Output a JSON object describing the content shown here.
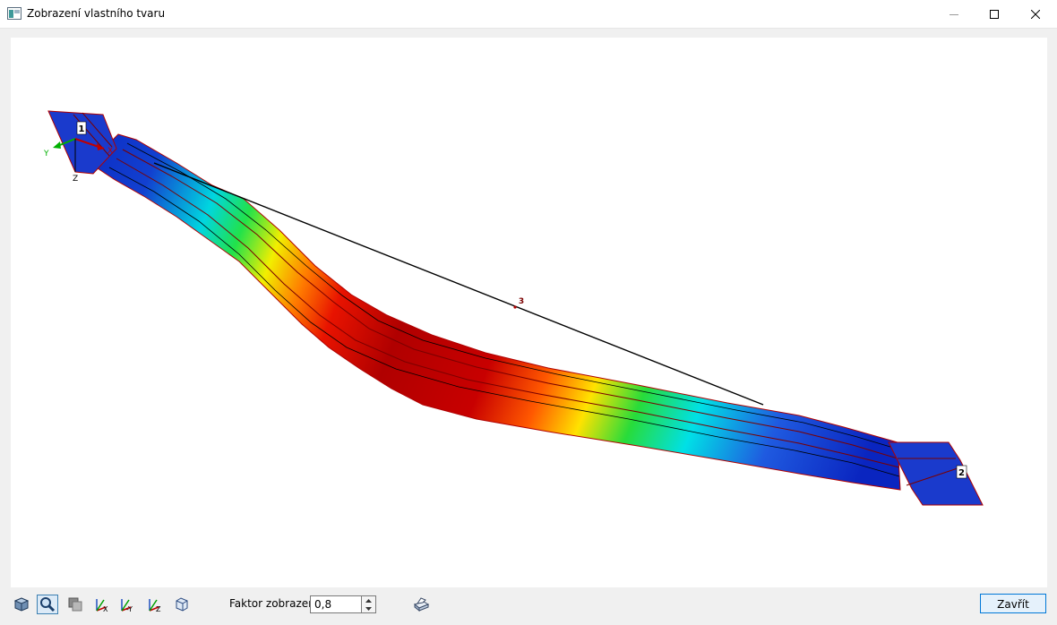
{
  "window": {
    "title": "Zobrazení vlastního tvaru"
  },
  "viewport": {
    "node_labels": [
      "1",
      "2",
      "3"
    ],
    "axes": {
      "x": "X",
      "y": "Y",
      "z": "Z"
    }
  },
  "toolbar": {
    "factor_label": "Faktor zobrazení:",
    "factor_value": "0,8",
    "icons": [
      "view-3d-icon",
      "zoom-icon",
      "render-mode-icon",
      "view-x-icon",
      "view-minus-y-icon",
      "view-z-icon",
      "isometric-box-icon",
      "print-icon"
    ],
    "axis_button_labels": [
      "X",
      "-Y",
      "Z"
    ],
    "close_label": "Zavřít"
  }
}
